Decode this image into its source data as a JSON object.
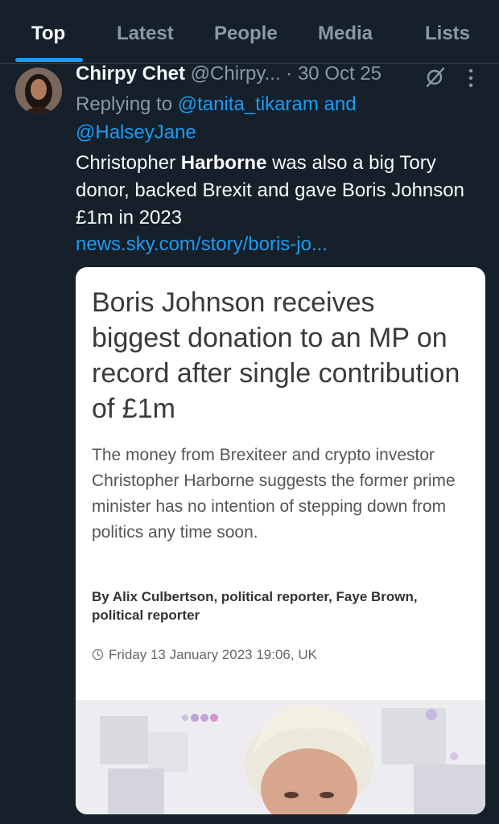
{
  "tabs": [
    {
      "label": "Top",
      "active": true
    },
    {
      "label": "Latest",
      "active": false
    },
    {
      "label": "People",
      "active": false
    },
    {
      "label": "Media",
      "active": false
    },
    {
      "label": "Lists",
      "active": false
    }
  ],
  "tweet": {
    "author_name": "Chirpy Chet",
    "handle": "@Chirpy...",
    "separator": " · ",
    "date": "30 Oct 25",
    "replying_to_prefix": "Replying to ",
    "replying_to_user1": "@tanita_tikaram",
    "replying_to_and": " and",
    "replying_to_user2": "@HalseyJane",
    "text_part1": "Christopher ",
    "text_bold": "Harborne",
    "text_part2": " was also a big Tory donor, backed Brexit and gave Boris Johnson £1m in 2023",
    "link": "news.sky.com/story/boris-jo..."
  },
  "card": {
    "headline": "Boris Johnson receives biggest donation to an MP on record after single contribution of £1m",
    "summary": "The money from Brexiteer and crypto investor Christopher Harborne suggests the former prime minister has no intention of stepping down from politics any time soon.",
    "byline": "By Alix Culbertson, political reporter, Faye Brown, political reporter",
    "date": "Friday 13 January 2023 19:06, UK"
  },
  "colors": {
    "background": "#15202b",
    "accent": "#1d9bf0",
    "muted": "#8b98a5"
  }
}
